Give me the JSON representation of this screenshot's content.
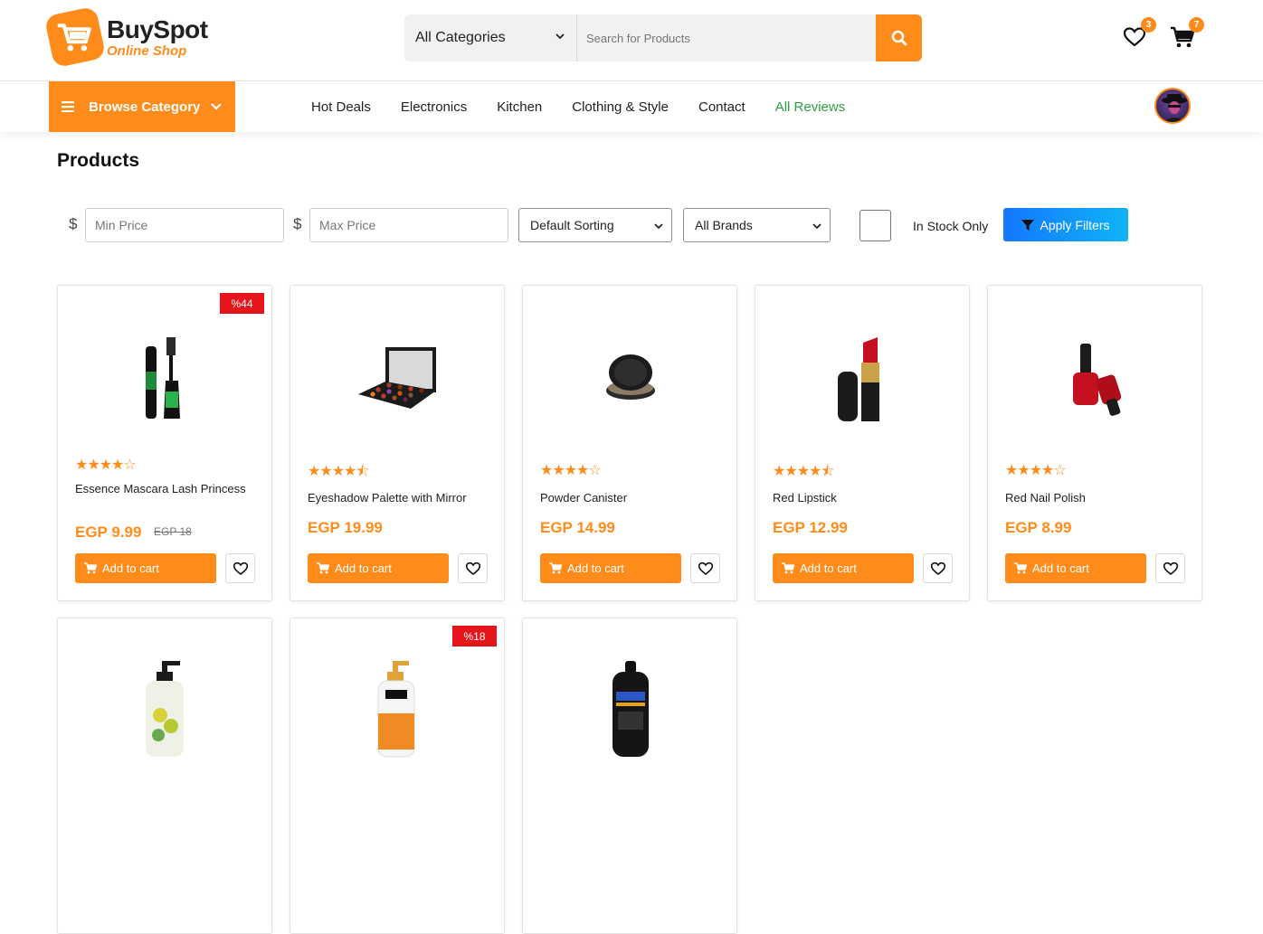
{
  "brand": {
    "title": "BuySpot",
    "subtitle": "Online Shop"
  },
  "search": {
    "category": "All Categories",
    "placeholder": "Search for Products"
  },
  "header": {
    "wishlist_count": "3",
    "cart_count": "7"
  },
  "nav": {
    "browse_label": "Browse Category",
    "links": [
      "Hot Deals",
      "Electronics",
      "Kitchen",
      "Clothing & Style",
      "Contact",
      "All Reviews"
    ]
  },
  "page_title": "Products",
  "filters": {
    "currency_symbol": "$",
    "min_placeholder": "Min Price",
    "max_placeholder": "Max Price",
    "sort_selected": "Default Sorting",
    "brand_selected": "All Brands",
    "in_stock_label": "In Stock Only",
    "apply_label": "Apply Filters"
  },
  "products": [
    {
      "name": "Essence Mascara Lash Princess",
      "price": "EGP 9.99",
      "old_price": "EGP 18",
      "discount": "%44",
      "stars": "★★★★☆",
      "add_label": "Add to cart"
    },
    {
      "name": "Eyeshadow Palette with Mirror",
      "price": "EGP 19.99",
      "old_price": "",
      "discount": "",
      "stars": "★★★★⯪",
      "add_label": "Add to cart"
    },
    {
      "name": "Powder Canister",
      "price": "EGP 14.99",
      "old_price": "",
      "discount": "",
      "stars": "★★★★☆",
      "add_label": "Add to cart"
    },
    {
      "name": "Red Lipstick",
      "price": "EGP 12.99",
      "old_price": "",
      "discount": "",
      "stars": "★★★★⯪",
      "add_label": "Add to cart"
    },
    {
      "name": "Red Nail Polish",
      "price": "EGP 8.99",
      "old_price": "",
      "discount": "",
      "stars": "★★★★☆",
      "add_label": "Add to cart"
    },
    {
      "name": "",
      "price": "",
      "old_price": "",
      "discount": "",
      "stars": "",
      "add_label": ""
    },
    {
      "name": "",
      "price": "",
      "old_price": "",
      "discount": "%18",
      "stars": "",
      "add_label": ""
    },
    {
      "name": "",
      "price": "",
      "old_price": "",
      "discount": "",
      "stars": "",
      "add_label": ""
    }
  ],
  "colors": {
    "accent": "#ff8c1a",
    "active_link": "#2ea043",
    "discount": "#e5151b",
    "apply_start": "#1577ff",
    "apply_end": "#0eb4f5"
  }
}
